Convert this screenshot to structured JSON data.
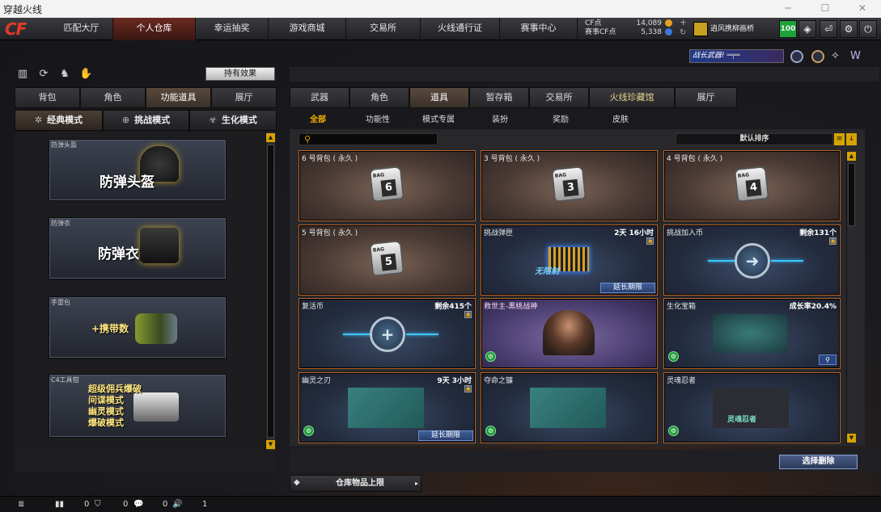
{
  "window": {
    "title": "穿越火线"
  },
  "nav": {
    "logo": "CF",
    "tabs": [
      {
        "label": "匹配大厅"
      },
      {
        "label": "个人仓库"
      },
      {
        "label": "幸运抽奖"
      },
      {
        "label": "游戏商城"
      },
      {
        "label": "交易所"
      },
      {
        "label": "火线通行证"
      },
      {
        "label": "赛事中心"
      }
    ],
    "active_tab": "个人仓库",
    "cf_label": "CF点",
    "cf_value": "14,089",
    "match_cf_label": "赛事CF点",
    "match_cf_value": "5,338",
    "username": "逍风携柳画桥",
    "level": "100"
  },
  "banner": {
    "text": "战长武器!"
  },
  "left": {
    "effect_button": "持有效果",
    "tabs": [
      {
        "label": "背包"
      },
      {
        "label": "角色"
      },
      {
        "label": "功能道具"
      },
      {
        "label": "展厅"
      }
    ],
    "active_tab": "功能道具",
    "modes": [
      {
        "label": "经典模式",
        "icon": "crosshair-icon"
      },
      {
        "label": "挑战模式",
        "icon": "plus-circle-icon"
      },
      {
        "label": "生化模式",
        "icon": "biohazard-icon"
      }
    ],
    "cards": [
      {
        "caption": "防弹头盔",
        "title": "防弹头盔"
      },
      {
        "caption": "防弹衣",
        "title": "防弹衣"
      },
      {
        "caption": "手雷包",
        "title": "+携带数"
      },
      {
        "caption": "C4工具钳",
        "lines": [
          "超级佣兵爆破",
          "间谍模式",
          "幽灵模式",
          "爆破模式"
        ]
      }
    ]
  },
  "right": {
    "tabs": [
      {
        "label": "武器"
      },
      {
        "label": "角色"
      },
      {
        "label": "道具"
      },
      {
        "label": "暂存箱"
      },
      {
        "label": "交易所"
      },
      {
        "label": "火线珍藏馆"
      },
      {
        "label": "展厅"
      }
    ],
    "active_tab": "道具",
    "categories": [
      {
        "label": "全部"
      },
      {
        "label": "功能性"
      },
      {
        "label": "模式专属"
      },
      {
        "label": "装扮"
      },
      {
        "label": "奖励"
      },
      {
        "label": "皮肤"
      }
    ],
    "active_category": "全部",
    "search_placeholder": "",
    "sort_label": "默认排序",
    "items": [
      {
        "name": "6 号背包 ( 永久 )",
        "bag_num": "6",
        "bag_label": "BAG"
      },
      {
        "name": "3 号背包 ( 永久 )",
        "bag_num": "3",
        "bag_label": "BAG"
      },
      {
        "name": "4 号背包 ( 永久 )",
        "bag_num": "4",
        "bag_label": "BAG"
      },
      {
        "name": "5 号背包 ( 永久 )",
        "bag_num": "5",
        "bag_label": "BAG"
      },
      {
        "name": "挑战弹匣",
        "meta": "2天 16小时",
        "extend": "延长期限",
        "badge": "无限制"
      },
      {
        "name": "挑战加入币",
        "meta": "剩余131个"
      },
      {
        "name": "复活币",
        "meta": "剩余415个"
      },
      {
        "name": "救世主-黑桃战神"
      },
      {
        "name": "生化宝箱",
        "meta": "成长率20.4%"
      },
      {
        "name": "幽灵之刃",
        "meta": "9天 3小时",
        "extend": "延长期限"
      },
      {
        "name": "夺命之镰"
      },
      {
        "name": "灵魂忍者",
        "badge": "灵魂忍者"
      }
    ],
    "select_delete": "选择删除",
    "warehouse_limit": "仓库物品上限"
  },
  "status": {
    "count1": "0",
    "count2": "0",
    "count3": "0",
    "count4": "1"
  }
}
